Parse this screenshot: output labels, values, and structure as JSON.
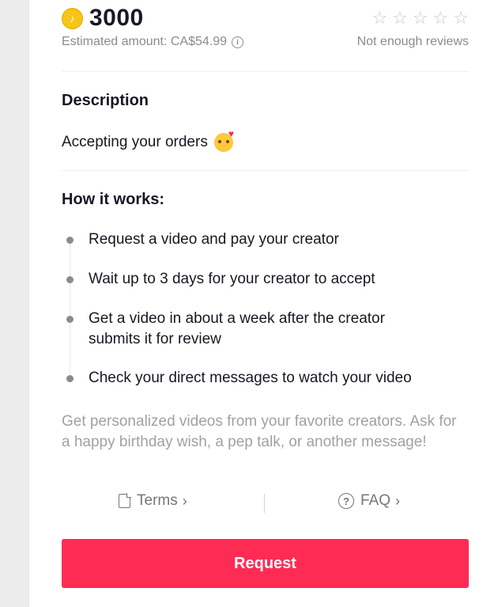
{
  "summary": {
    "coin_icon": "tiktok-coin-icon",
    "coin_amount": "3000",
    "estimated_amount": "Estimated amount: CA$54.99",
    "rating_stars": 5,
    "reviews_status": "Not enough reviews"
  },
  "description": {
    "title": "Description",
    "text": "Accepting your orders",
    "emoji": "smiling-face-with-hearts"
  },
  "how_it_works": {
    "title": "How it works:",
    "steps": [
      "Request a video and pay your creator",
      "Wait up to 3 days for your creator to accept",
      "Get a video in about a week after the creator submits it for review",
      "Check your direct messages to watch your video"
    ]
  },
  "promo_text": "Get personalized videos from your favorite creators. Ask for a happy birthday wish, a pep talk, or another message!",
  "links": {
    "terms": "Terms",
    "faq": "FAQ"
  },
  "request_button": "Request",
  "colors": {
    "accent": "#fe2c55",
    "coin": "#f5c518",
    "muted_text": "#8a8b91"
  }
}
